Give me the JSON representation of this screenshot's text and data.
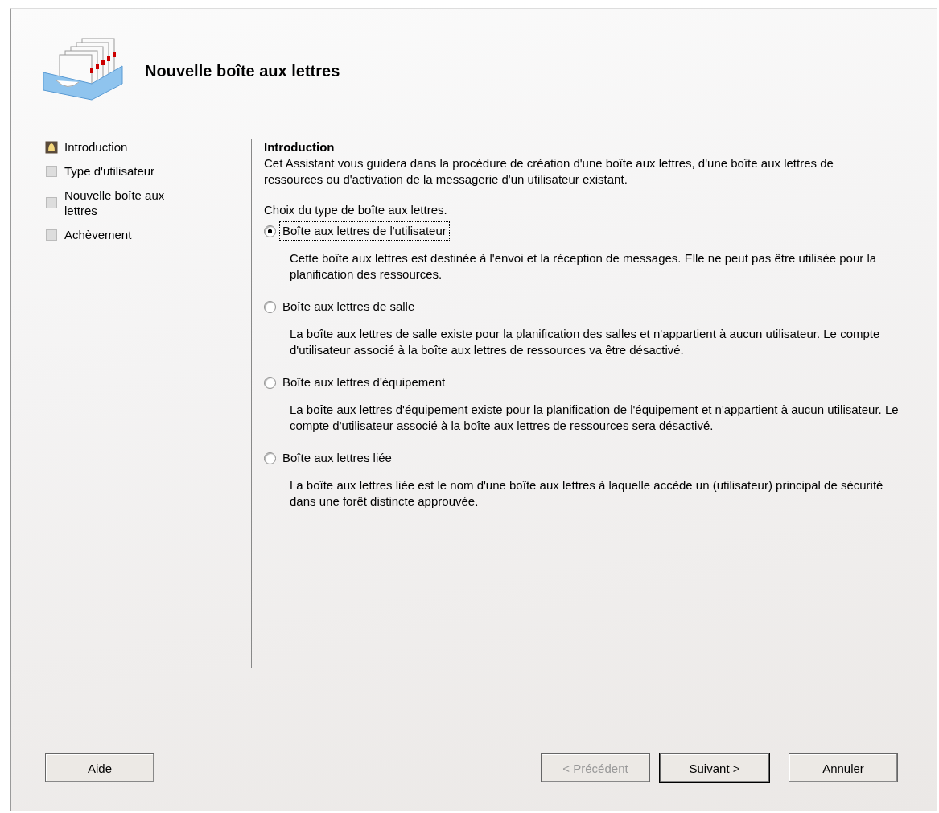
{
  "header": {
    "title": "Nouvelle boîte aux lettres"
  },
  "steps": [
    {
      "label": "Introduction",
      "selected": true
    },
    {
      "label": "Type d'utilisateur",
      "selected": false
    },
    {
      "label": "Nouvelle boîte aux lettres",
      "selected": false
    },
    {
      "label": "Achèvement",
      "selected": false
    }
  ],
  "content": {
    "heading": "Introduction",
    "intro": "Cet Assistant vous guidera dans la procédure de création d'une boîte aux lettres, d'une boîte aux lettres de ressources ou d'activation de la messagerie d'un utilisateur existant.",
    "prompt": "Choix du type de boîte aux lettres.",
    "options": [
      {
        "label": "Boîte aux lettres de l'utilisateur",
        "selected": true,
        "description": "Cette boîte aux lettres est destinée à l'envoi et la réception de messages. Elle ne peut pas être utilisée pour la planification des ressources."
      },
      {
        "label": "Boîte aux lettres de salle",
        "selected": false,
        "description": "La boîte aux lettres de salle existe pour la planification des salles et n'appartient à aucun utilisateur. Le compte d'utilisateur associé à la boîte aux lettres de ressources va être désactivé."
      },
      {
        "label": "Boîte aux lettres d'équipement",
        "selected": false,
        "description": "La boîte aux lettres d'équipement existe pour la planification de l'équipement et n'appartient à aucun utilisateur. Le compte d'utilisateur associé à la boîte aux lettres de ressources sera désactivé."
      },
      {
        "label": "Boîte aux lettres liée",
        "selected": false,
        "description": "La boîte aux lettres liée est le nom d'une boîte aux lettres à laquelle accède un (utilisateur) principal de sécurité dans une forêt distincte approuvée."
      }
    ]
  },
  "buttons": [
    {
      "label": "Aide",
      "disabled": false
    },
    {
      "label": "< Précédent",
      "disabled": true
    },
    {
      "label": "Suivant >",
      "disabled": false
    },
    {
      "label": "Annuler",
      "disabled": false
    }
  ]
}
